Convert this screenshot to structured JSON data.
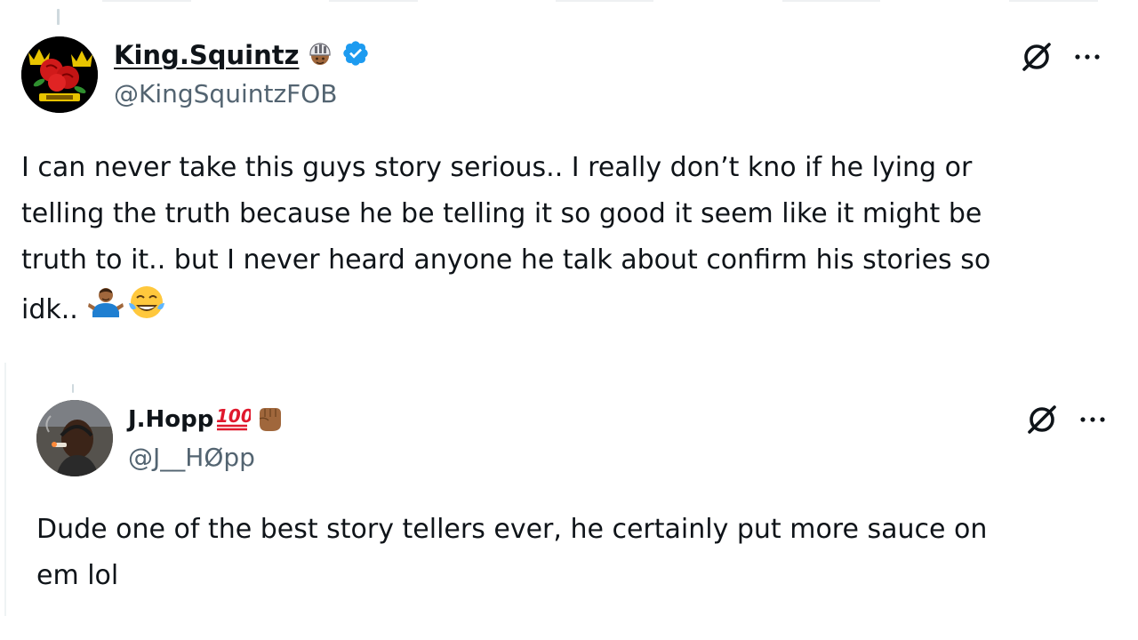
{
  "tweets": [
    {
      "display_name": "King.Squintz",
      "handle": "@KingSquintzFOB",
      "verified": true,
      "text_lines": [
        "I can never take this guys story serious.. I really don’t kno if he lying or",
        "telling the truth because he be telling it so good it seem like it might be",
        "truth to it.. but I never heard anyone he talk about confirm his stories so",
        "idk.."
      ],
      "name_emoji": "person-with-helmet-emoji",
      "text_emojis": [
        "man-shrugging-emoji",
        "face-with-tears-of-joy-emoji"
      ]
    },
    {
      "display_name": "J.Hopp",
      "handle": "@J__HØpp",
      "verified": false,
      "text_lines": [
        "Dude one of the best story tellers ever, he certainly put more sauce on",
        "em lol"
      ],
      "name_emojis": [
        "hundred-points-emoji",
        "raised-fist-emoji"
      ]
    }
  ],
  "colors": {
    "text": "#0f1419",
    "secondary": "#536471",
    "verified": "#1d9bf0",
    "divider": "#cfd9de"
  },
  "icons": [
    "grok-icon",
    "more-icon",
    "verified-badge-icon"
  ]
}
